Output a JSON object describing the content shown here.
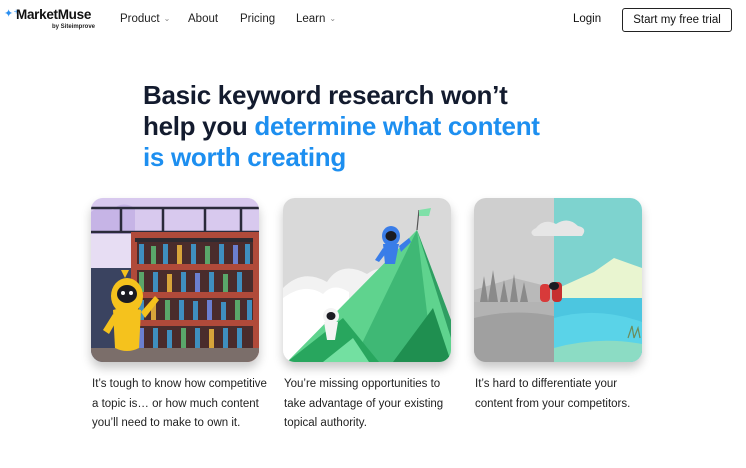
{
  "brand": {
    "name": "MarketMuse",
    "sub": "by Siteimprove"
  },
  "nav": [
    {
      "label": "Product",
      "dropdown": true
    },
    {
      "label": "About",
      "dropdown": false
    },
    {
      "label": "Pricing",
      "dropdown": false
    },
    {
      "label": "Learn",
      "dropdown": true
    }
  ],
  "header": {
    "login": "Login",
    "cta": "Start my free trial"
  },
  "hero": {
    "line1": "Basic keyword research won’t",
    "line2_dark": "help you ",
    "line2_blue": "determine what content",
    "line3_blue": "is worth creating"
  },
  "cards": [
    {
      "text": "It’s tough to know how competitive a topic is… or how much content you’ll need to make to own it.",
      "illustration": "library-character-illustration"
    },
    {
      "text": "You’re missing opportunities to take advantage of your existing topical authority.",
      "illustration": "mountain-flag-illustration"
    },
    {
      "text": "It’s hard to differentiate your content from your competitors.",
      "illustration": "split-landscape-illustration"
    }
  ],
  "colors": {
    "accent": "#1d8ff0",
    "heading": "#131b2e"
  }
}
